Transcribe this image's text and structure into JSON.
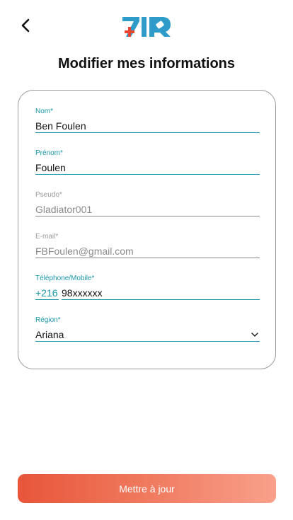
{
  "header": {
    "back_icon": "chevron-left-icon",
    "logo_text": "7IR"
  },
  "page": {
    "title": "Modifier mes informations"
  },
  "form": {
    "nom": {
      "label": "Nom*",
      "value": "Ben Foulen"
    },
    "prenom": {
      "label": "Prénom*",
      "value": "Foulen"
    },
    "pseudo": {
      "label": "Pseudo*",
      "value": "Gladiator001"
    },
    "email": {
      "label": "E-mail*",
      "value": "FBFoulen@gmail.com"
    },
    "telephone": {
      "label": "Téléphone/Mobile*",
      "prefix": "+216",
      "value": "98xxxxxx"
    },
    "region": {
      "label": "Région*",
      "value": "Ariana",
      "icon": "chevron-down-icon"
    }
  },
  "actions": {
    "update_label": "Mettre à jour"
  },
  "colors": {
    "accent": "#1a96aa",
    "button_start": "#e8553a",
    "button_end": "#f9a08b",
    "logo_blue": "#2e9bc9",
    "logo_red": "#e8452f"
  }
}
